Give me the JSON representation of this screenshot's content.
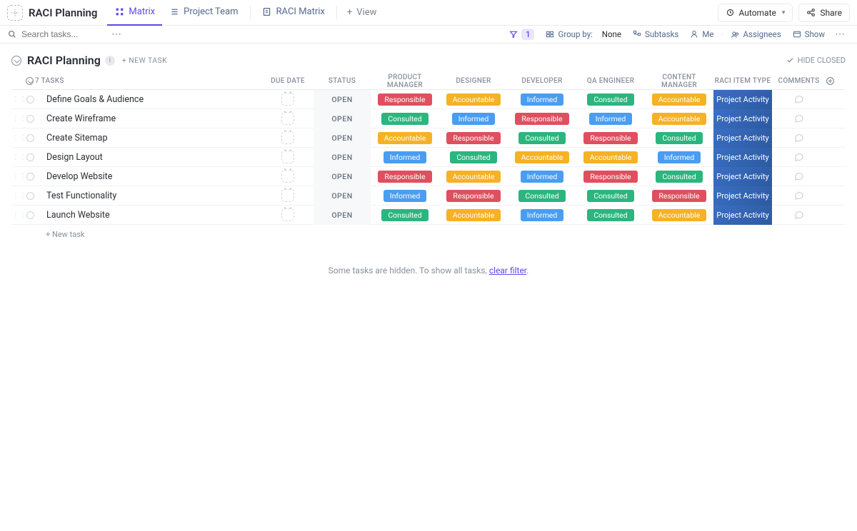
{
  "header": {
    "title": "RACI Planning",
    "tabs": [
      {
        "label": "Matrix",
        "active": true
      },
      {
        "label": "Project Team",
        "active": false
      },
      {
        "label": "RACI Matrix",
        "active": false
      }
    ],
    "view_label": "View",
    "automate_label": "Automate",
    "share_label": "Share"
  },
  "toolbar": {
    "search_placeholder": "Search tasks...",
    "filter_count": "1",
    "group_by_label": "Group by:",
    "group_by_value": "None",
    "subtasks_label": "Subtasks",
    "me_label": "Me",
    "assignees_label": "Assignees",
    "show_label": "Show"
  },
  "section": {
    "title": "RACI Planning",
    "new_task_label": "+ NEW TASK",
    "hide_closed_label": "HIDE CLOSED"
  },
  "columns": {
    "task_count": "7 TASKS",
    "due_date": "DUE DATE",
    "status": "STATUS",
    "product_manager": "PRODUCT MANAGER",
    "designer": "DESIGNER",
    "developer": "DEVELOPER",
    "qa_engineer": "QA ENGINEER",
    "content_manager": "CONTENT MANAGER",
    "raci_item_type": "RACI ITEM TYPE",
    "comments": "COMMENTS"
  },
  "raci_colors": {
    "Responsible": "#e04f5f",
    "Accountable": "#f5b225",
    "Consulted": "#2cb57e",
    "Informed": "#4a9df0"
  },
  "tasks": [
    {
      "name": "Define Goals & Audience",
      "status": "OPEN",
      "pm": "Responsible",
      "designer": "Accountable",
      "developer": "Informed",
      "qa": "Consulted",
      "cm": "Accountable",
      "raci": "Project Activity"
    },
    {
      "name": "Create Wireframe",
      "status": "OPEN",
      "pm": "Consulted",
      "designer": "Informed",
      "developer": "Responsible",
      "qa": "Informed",
      "cm": "Accountable",
      "raci": "Project Activity"
    },
    {
      "name": "Create Sitemap",
      "status": "OPEN",
      "pm": "Accountable",
      "designer": "Responsible",
      "developer": "Consulted",
      "qa": "Responsible",
      "cm": "Consulted",
      "raci": "Project Activity"
    },
    {
      "name": "Design Layout",
      "status": "OPEN",
      "pm": "Informed",
      "designer": "Consulted",
      "developer": "Accountable",
      "qa": "Accountable",
      "cm": "Informed",
      "raci": "Project Activity"
    },
    {
      "name": "Develop Website",
      "status": "OPEN",
      "pm": "Responsible",
      "designer": "Accountable",
      "developer": "Informed",
      "qa": "Responsible",
      "cm": "Consulted",
      "raci": "Project Activity"
    },
    {
      "name": "Test Functionality",
      "status": "OPEN",
      "pm": "Informed",
      "designer": "Responsible",
      "developer": "Consulted",
      "qa": "Consulted",
      "cm": "Responsible",
      "raci": "Project Activity"
    },
    {
      "name": "Launch Website",
      "status": "OPEN",
      "pm": "Consulted",
      "designer": "Accountable",
      "developer": "Informed",
      "qa": "Consulted",
      "cm": "Accountable",
      "raci": "Project Activity"
    }
  ],
  "footer": {
    "new_task_label": "+ New task",
    "hidden_msg_prefix": "Some tasks are hidden. To show all tasks, ",
    "hidden_msg_link": "clear filter",
    "hidden_msg_suffix": "."
  }
}
